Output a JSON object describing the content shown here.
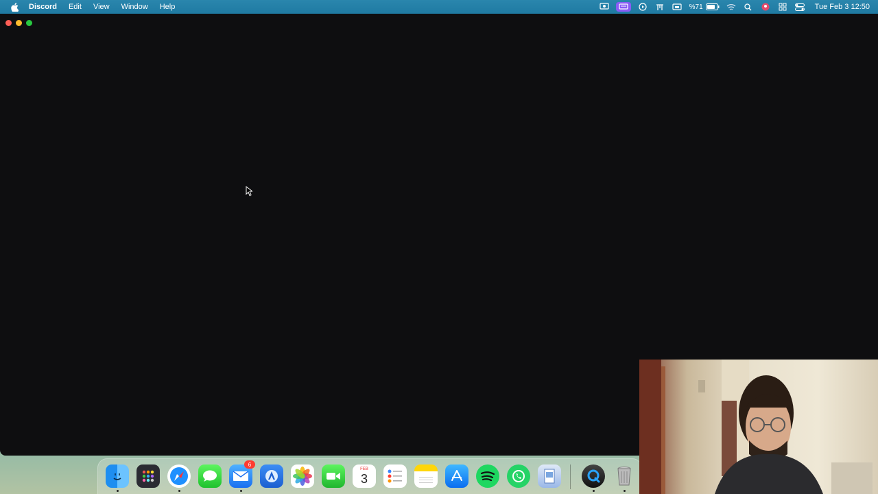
{
  "menubar": {
    "app_name": "Discord",
    "menus": [
      "Edit",
      "View",
      "Window",
      "Help"
    ],
    "battery_percent": "%71",
    "clock": "Tue Feb 3  12:50"
  },
  "dock": {
    "apps": [
      {
        "name": "Finder",
        "icon": "finder-icon"
      },
      {
        "name": "Launchpad",
        "icon": "launchpad-icon"
      },
      {
        "name": "Safari",
        "icon": "safari-icon"
      },
      {
        "name": "Messages",
        "icon": "messages-icon"
      },
      {
        "name": "Mail",
        "icon": "mail-icon",
        "badge": "6"
      },
      {
        "name": "Xcode",
        "icon": "xcode-icon"
      },
      {
        "name": "Photos",
        "icon": "photos-icon"
      },
      {
        "name": "FaceTime",
        "icon": "facetime-icon"
      },
      {
        "name": "Calendar",
        "icon": "calendar-icon",
        "day": "3",
        "month": "FEB"
      },
      {
        "name": "Reminders",
        "icon": "reminders-icon"
      },
      {
        "name": "Notes",
        "icon": "notes-icon"
      },
      {
        "name": "App Store",
        "icon": "appstore-icon"
      },
      {
        "name": "Spotify",
        "icon": "spotify-icon"
      },
      {
        "name": "WhatsApp",
        "icon": "whatsapp-icon"
      },
      {
        "name": "Preview",
        "icon": "preview-icon"
      },
      {
        "name": "QuickTime Player",
        "icon": "quicktime-icon"
      },
      {
        "name": "Trash",
        "icon": "trash-icon"
      }
    ]
  },
  "colors": {
    "menubar": "#2180a8",
    "window_bg": "#0e0e10",
    "badge": "#ff3b30"
  }
}
